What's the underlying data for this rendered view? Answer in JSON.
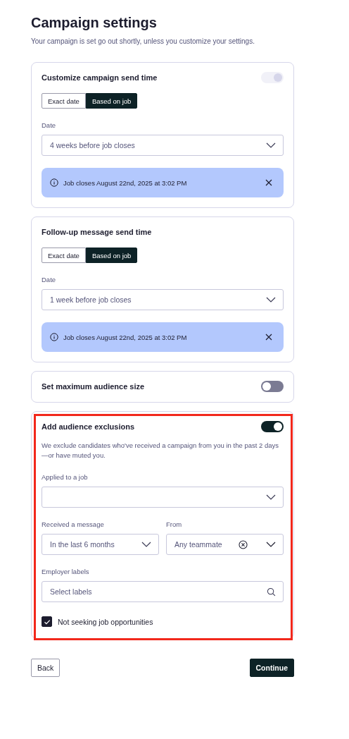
{
  "header": {
    "title": "Campaign settings",
    "subtitle": "Your campaign is set go out shortly, unless you customize your settings."
  },
  "cards": [
    {
      "kind": "schedule",
      "title": "Customize campaign send time",
      "toggle": {
        "on": true,
        "disabled": true
      },
      "segments": [
        {
          "label": "Exact date",
          "selected": false
        },
        {
          "label": "Based on job",
          "selected": true
        }
      ],
      "field_label": "Date",
      "select_value": "4 weeks before job closes",
      "notice": "Job closes August 22nd, 2025 at 3:02 PM"
    },
    {
      "kind": "schedule",
      "title": "Follow-up message send time",
      "segments": [
        {
          "label": "Exact date",
          "selected": false
        },
        {
          "label": "Based on job",
          "selected": true
        }
      ],
      "field_label": "Date",
      "select_value": "1 week before job closes",
      "notice": "Job closes August 22nd, 2025 at 3:02 PM"
    },
    {
      "kind": "switch",
      "title": "Set maximum audience size",
      "toggle": {
        "on": false,
        "disabled": false
      }
    },
    {
      "kind": "exclusions",
      "title": "Add audience exclusions",
      "toggle": {
        "on": true,
        "disabled": false
      },
      "highlighted": true,
      "description": "We exclude candidates who've received a campaign from you in the past 2 days —or have muted you.",
      "applied_label": "Applied to a job",
      "received": {
        "label": "Received a message",
        "value": "In the last 6 months"
      },
      "from": {
        "label": "From",
        "value": "Any teammate"
      },
      "labels": {
        "label": "Employer labels",
        "placeholder": "Select labels"
      },
      "checkbox": {
        "label": "Not seeking job opportunities",
        "checked": true
      }
    }
  ],
  "buttons": {
    "back": "Back",
    "continue": "Continue"
  }
}
